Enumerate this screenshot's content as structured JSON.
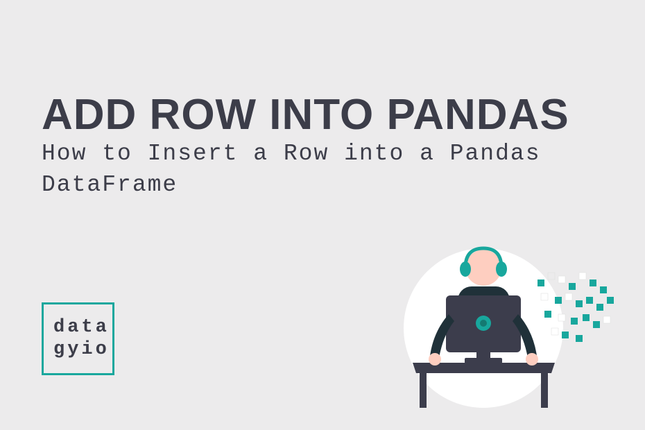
{
  "title": "ADD ROW INTO PANDAS",
  "subtitle": "How to Insert a Row into a Pandas DataFrame",
  "logo": {
    "line1": "data",
    "line2": "gyio"
  },
  "colors": {
    "background": "#ecebec",
    "text": "#3c3d49",
    "accent": "#18a79d",
    "skin": "#fecec0",
    "dark": "#3c3d4c",
    "white": "#ffffff"
  }
}
